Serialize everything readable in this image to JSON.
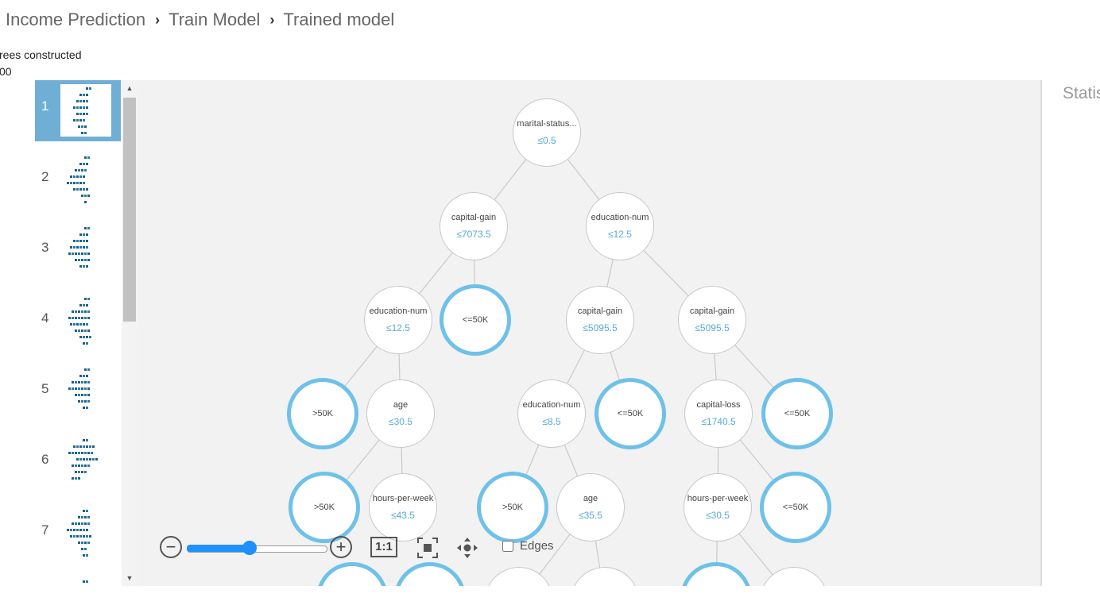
{
  "breadcrumb": {
    "items": [
      "Income Prediction",
      "Train Model",
      "Trained model"
    ],
    "separator": "›"
  },
  "info": {
    "trees_label": "rees constructed",
    "trees_value": "00"
  },
  "stats_title": "Statis",
  "thumbnails": [
    "1",
    "2",
    "3",
    "4",
    "5",
    "6",
    "7"
  ],
  "selected_tree": "1",
  "colors": {
    "accent": "#6ec1e8",
    "selected_thumb": "#6fafd6",
    "slider": "#1e90ff",
    "canvas_bg": "#f2f2f2"
  },
  "tree": {
    "nodes": {
      "n0": {
        "label": "marital-status...",
        "threshold": "≤0.5"
      },
      "n1": {
        "label": "capital-gain",
        "threshold": "≤7073.5"
      },
      "n2": {
        "label": "education-num",
        "threshold": "≤12.5"
      },
      "n3": {
        "label": "education-num",
        "threshold": "≤12.5"
      },
      "n4": {
        "label": "<=50K"
      },
      "n5": {
        "label": "capital-gain",
        "threshold": "≤5095.5"
      },
      "n6": {
        "label": "capital-gain",
        "threshold": "≤5095.5"
      },
      "n7": {
        "label": ">50K"
      },
      "n8": {
        "label": "age",
        "threshold": "≤30.5"
      },
      "n9": {
        "label": "education-num",
        "threshold": "≤8.5"
      },
      "n10": {
        "label": "<=50K"
      },
      "n11": {
        "label": "capital-loss",
        "threshold": "≤1740.5"
      },
      "n12": {
        "label": "<=50K"
      },
      "n13": {
        "label": ">50K"
      },
      "n14": {
        "label": "hours-per-week",
        "threshold": "≤43.5"
      },
      "n15": {
        "label": ">50K"
      },
      "n16": {
        "label": "age",
        "threshold": "≤35.5"
      },
      "n17": {
        "label": "hours-per-week",
        "threshold": "≤30.5"
      },
      "n18": {
        "label": "<=50K"
      }
    }
  },
  "zoom_controls": {
    "zoom_out_icon": "minus-circle-icon",
    "zoom_in_icon": "plus-circle-icon",
    "zoom_level": 0.45,
    "actual_size_label": "1:1",
    "fit_icon": "fit-to-screen-icon",
    "pan_icon": "pan-arrows-icon",
    "edges_label": "Edges",
    "edges_checked": false
  }
}
